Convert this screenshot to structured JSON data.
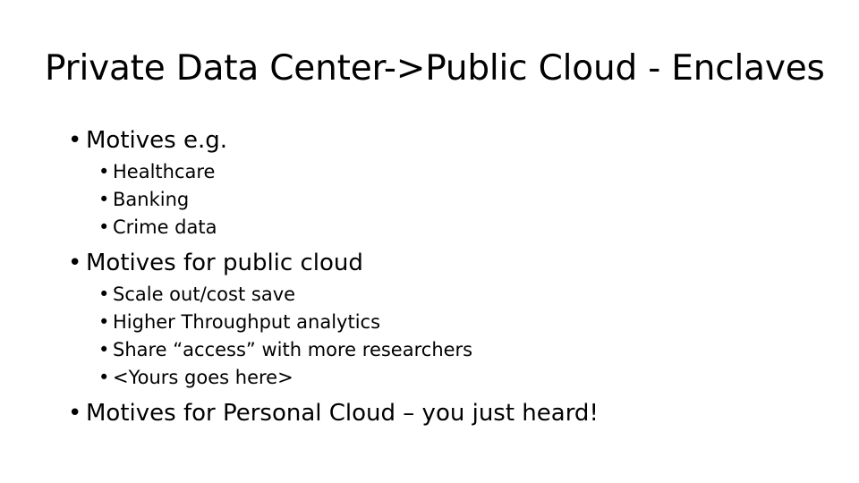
{
  "slide": {
    "title": "Private Data Center->Public Cloud - Enclaves",
    "background_color": "#ffffff",
    "text_color": "#000000",
    "bullet_glyph": "•",
    "groups": [
      {
        "heading": "Motives e.g.",
        "items": [
          "Healthcare",
          "Banking",
          "Crime data"
        ]
      },
      {
        "heading": "Motives for public cloud",
        "items": [
          "Scale out/cost save",
          "Higher Throughput analytics",
          "Share “access” with more researchers",
          "<Yours goes here>"
        ]
      },
      {
        "heading": "Motives for Personal Cloud – you just heard!",
        "items": []
      }
    ]
  }
}
